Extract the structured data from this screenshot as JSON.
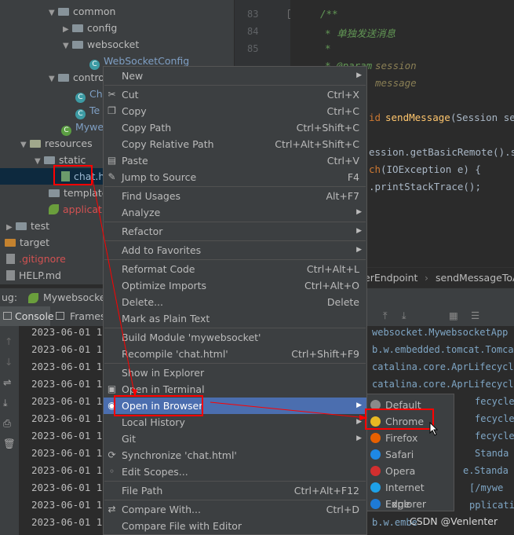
{
  "tree": {
    "rows": [
      {
        "label": "common",
        "kind": "folder",
        "expanded": true
      },
      {
        "label": "config",
        "kind": "folder",
        "expanded": false
      },
      {
        "label": "websocket",
        "kind": "folder",
        "expanded": true
      },
      {
        "label": "WebSocketConfig",
        "kind": "class"
      },
      {
        "label": "contro",
        "kind": "folder",
        "expanded": true
      },
      {
        "label": "Ch",
        "kind": "class"
      },
      {
        "label": "Te",
        "kind": "class"
      },
      {
        "label": "Mywe",
        "kind": "class"
      },
      {
        "label": "resources",
        "kind": "folder",
        "expanded": true
      },
      {
        "label": "static",
        "kind": "folder",
        "expanded": true
      },
      {
        "label": "chat.h",
        "kind": "html"
      },
      {
        "label": "template",
        "kind": "folder"
      },
      {
        "label": "applicatio",
        "kind": "leaf"
      },
      {
        "label": "test",
        "kind": "folder",
        "expanded": false
      },
      {
        "label": "target",
        "kind": "folder"
      },
      {
        "label": ".gitignore",
        "kind": "file"
      },
      {
        "label": "HELP.md",
        "kind": "file"
      }
    ]
  },
  "editor": {
    "line_numbers": [
      "83",
      "84",
      "85"
    ],
    "comment_open": "/**",
    "comment_cn": "* 单独发送消息",
    "comment_star": "*",
    "param_tag": "* @param",
    "param_session": "session",
    "param_message": "message",
    "sig_kw": "id",
    "sig_fn": "sendMessage",
    "sig_rest": "(Session sess",
    "code_line1": "ession.getBasicRemote().ser",
    "code_catch_kw": "ch",
    "code_catch_rest": " (IOException e) {",
    "code_line3": ".printStackTrace();"
  },
  "breadcrumb": {
    "part1": "erEndpoint",
    "sep": "›",
    "part2": "sendMessageToA"
  },
  "run": {
    "label": "ug:",
    "config": "Mywebsocke",
    "tab_console": "Console",
    "tab_frames": "Frames"
  },
  "console": {
    "timestamp": "2023-06-01 18",
    "right_lines": [
      "websocket.MywebsocketApp",
      "b.w.embedded.tomcat.Tomcat",
      "catalina.core.AprLifecycle",
      "catalina.core.AprLifecycle",
      "fecycle",
      "fecycle",
      "fecycle",
      "Standa",
      "e.Standa",
      "[/mywe",
      "pplicati",
      "b.w.embe"
    ]
  },
  "context_menu": {
    "items": [
      {
        "label": "New",
        "shortcut": "",
        "submenu": true,
        "icon": ""
      },
      {
        "sep": true
      },
      {
        "label": "Cut",
        "shortcut": "Ctrl+X",
        "icon": "✂"
      },
      {
        "label": "Copy",
        "shortcut": "Ctrl+C",
        "icon": "❐"
      },
      {
        "label": "Copy Path",
        "shortcut": "Ctrl+Shift+C",
        "icon": ""
      },
      {
        "label": "Copy Relative Path",
        "shortcut": "Ctrl+Alt+Shift+C",
        "icon": ""
      },
      {
        "label": "Paste",
        "shortcut": "Ctrl+V",
        "icon": "▤"
      },
      {
        "label": "Jump to Source",
        "shortcut": "F4",
        "icon": "✎"
      },
      {
        "sep": true
      },
      {
        "label": "Find Usages",
        "shortcut": "Alt+F7",
        "icon": ""
      },
      {
        "label": "Analyze",
        "shortcut": "",
        "submenu": true,
        "icon": ""
      },
      {
        "sep": true
      },
      {
        "label": "Refactor",
        "shortcut": "",
        "submenu": true,
        "icon": ""
      },
      {
        "sep": true
      },
      {
        "label": "Add to Favorites",
        "shortcut": "",
        "submenu": true,
        "icon": ""
      },
      {
        "sep": true
      },
      {
        "label": "Reformat Code",
        "shortcut": "Ctrl+Alt+L",
        "icon": ""
      },
      {
        "label": "Optimize Imports",
        "shortcut": "Ctrl+Alt+O",
        "icon": ""
      },
      {
        "label": "Delete...",
        "shortcut": "Delete",
        "icon": ""
      },
      {
        "label": "Mark as Plain Text",
        "shortcut": "",
        "icon": ""
      },
      {
        "sep": true
      },
      {
        "label": "Build Module 'mywebsocket'",
        "shortcut": "",
        "icon": ""
      },
      {
        "label": "Recompile 'chat.html'",
        "shortcut": "Ctrl+Shift+F9",
        "icon": ""
      },
      {
        "sep": true
      },
      {
        "label": "Show in Explorer",
        "shortcut": "",
        "icon": ""
      },
      {
        "label": "Open in Terminal",
        "shortcut": "",
        "icon": "▣"
      },
      {
        "label": "Open in Browser",
        "shortcut": "",
        "submenu": true,
        "icon": "◉",
        "highlighted": true
      },
      {
        "label": "Local History",
        "shortcut": "",
        "submenu": true,
        "icon": ""
      },
      {
        "label": "Git",
        "shortcut": "",
        "submenu": true,
        "icon": ""
      },
      {
        "label": "Synchronize 'chat.html'",
        "shortcut": "",
        "icon": "⟳"
      },
      {
        "label": "Edit Scopes...",
        "shortcut": "",
        "icon": "◦"
      },
      {
        "sep": true
      },
      {
        "label": "File Path",
        "shortcut": "Ctrl+Alt+F12",
        "icon": ""
      },
      {
        "sep": true
      },
      {
        "label": "Compare With...",
        "shortcut": "Ctrl+D",
        "icon": "⇄"
      },
      {
        "label": "Compare File with Editor",
        "shortcut": "",
        "icon": ""
      }
    ]
  },
  "browser_menu": {
    "items": [
      {
        "label": "Default",
        "color": "#8a8a8a"
      },
      {
        "label": "Chrome",
        "color": "#e8b923"
      },
      {
        "label": "Firefox",
        "color": "#e66000"
      },
      {
        "label": "Safari",
        "color": "#1e88e5"
      },
      {
        "label": "Opera",
        "color": "#d32f2f"
      },
      {
        "label": "Internet Explorer",
        "color": "#1ea1e8"
      },
      {
        "label": "Edge",
        "color": "#1e7ad6"
      }
    ]
  },
  "watermark": "CSDN @Venlenter"
}
